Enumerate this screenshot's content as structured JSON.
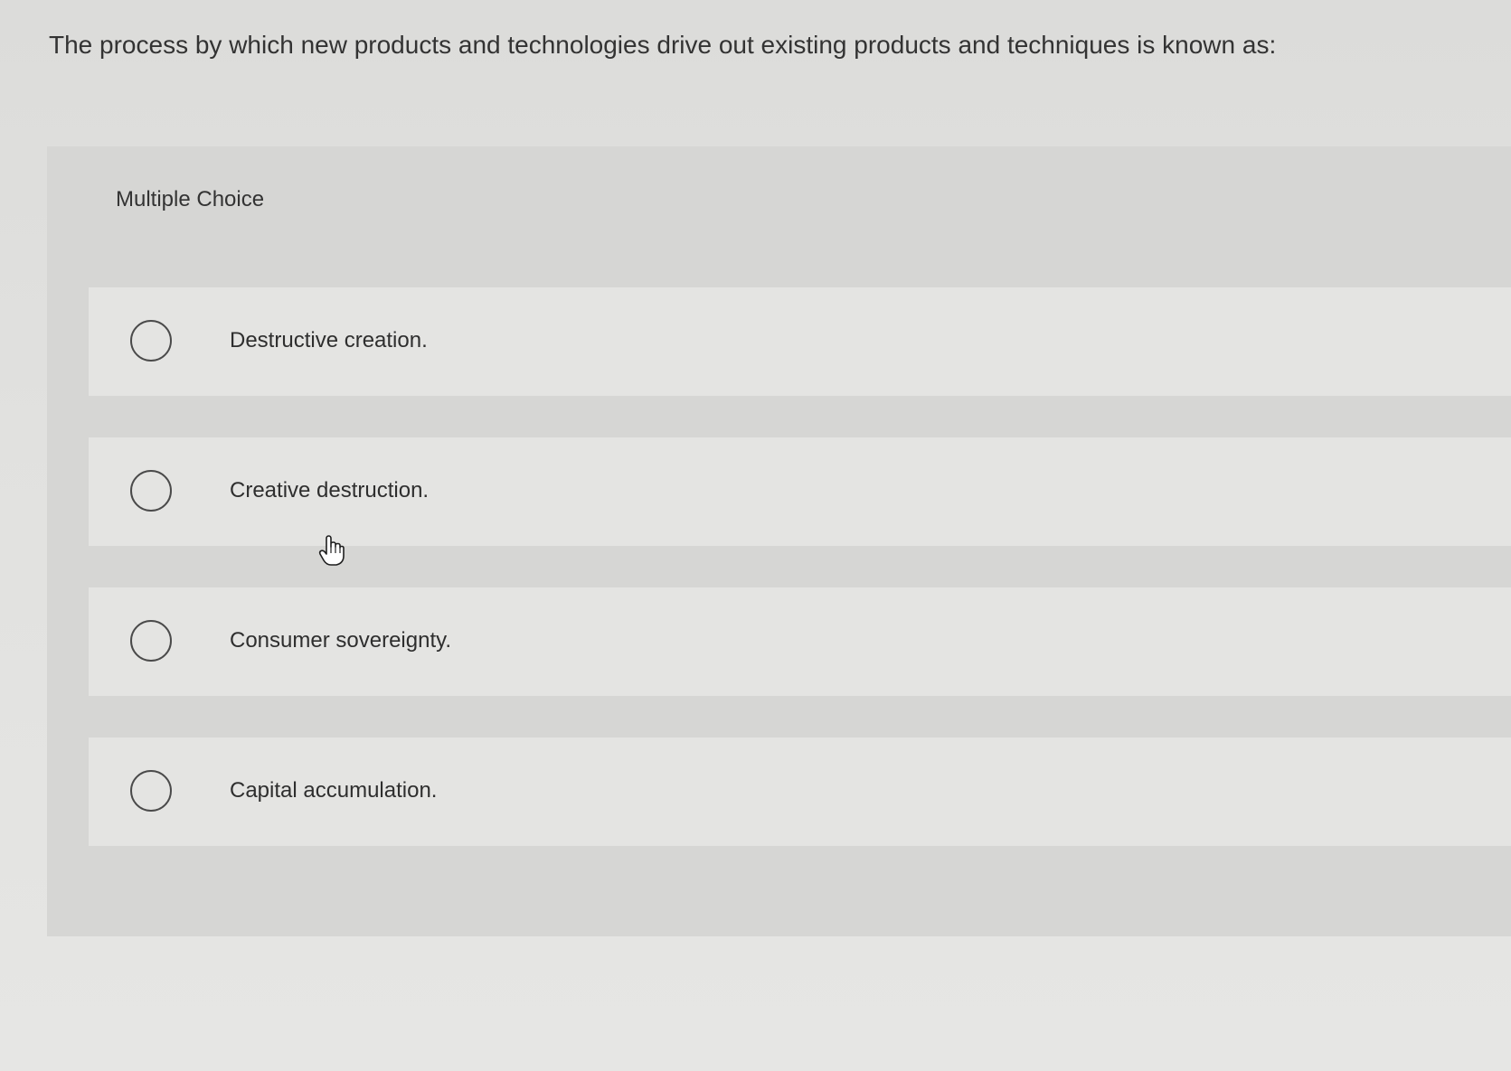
{
  "question": {
    "text": "The process by which new products and technologies drive out existing products and techniques is known as:"
  },
  "panel": {
    "label": "Multiple Choice"
  },
  "options": [
    {
      "label": "Destructive creation.",
      "selected": false
    },
    {
      "label": "Creative destruction.",
      "selected": false
    },
    {
      "label": "Consumer sovereignty.",
      "selected": false
    },
    {
      "label": "Capital accumulation.",
      "selected": false
    }
  ],
  "cursor": {
    "icon": "hand-pointer-icon"
  },
  "colors": {
    "background": "#e1e1df",
    "panel": "#d6d6d4",
    "option_row": "#e4e4e2",
    "text": "#333333",
    "radio_border": "#4a4a4a"
  }
}
